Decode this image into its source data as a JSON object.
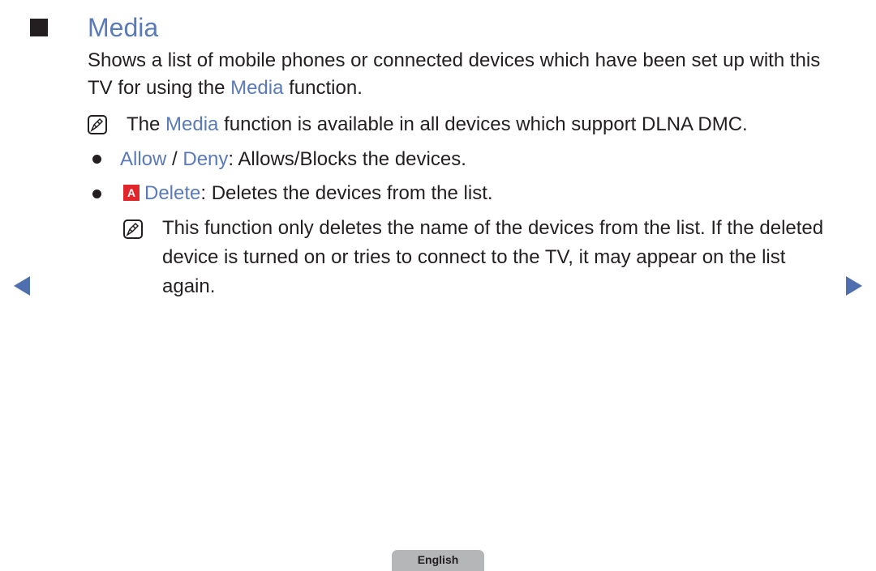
{
  "section": {
    "title": "Media",
    "description_pre": "Shows a list of mobile phones or connected devices which have been set up with this TV for using the ",
    "description_highlight": "Media",
    "description_post": " function."
  },
  "note1": {
    "icon": "note-icon",
    "pre": "The ",
    "highlight": "Media",
    "post": " function is available in all devices which support DLNA DMC."
  },
  "bullets": [
    {
      "highlight1": "Allow",
      "sep": " / ",
      "highlight2": "Deny",
      "text": ": Allows/Blocks the devices."
    },
    {
      "button_icon": "A",
      "highlight": "Delete",
      "text": ": Deletes the devices from the list."
    }
  ],
  "note2": {
    "icon": "note-icon",
    "text": "This function only deletes the name of the devices from the list. If the deleted device is turned on or tries to connect to the TV, it may appear on the list again."
  },
  "navigation": {
    "prev": "previous-page",
    "next": "next-page"
  },
  "footer": {
    "language": "English"
  },
  "colors": {
    "accent": "#5a7ab8",
    "nav": "#4f6fae",
    "a_button": "#e0262a",
    "tab": "#b5b6b8"
  }
}
